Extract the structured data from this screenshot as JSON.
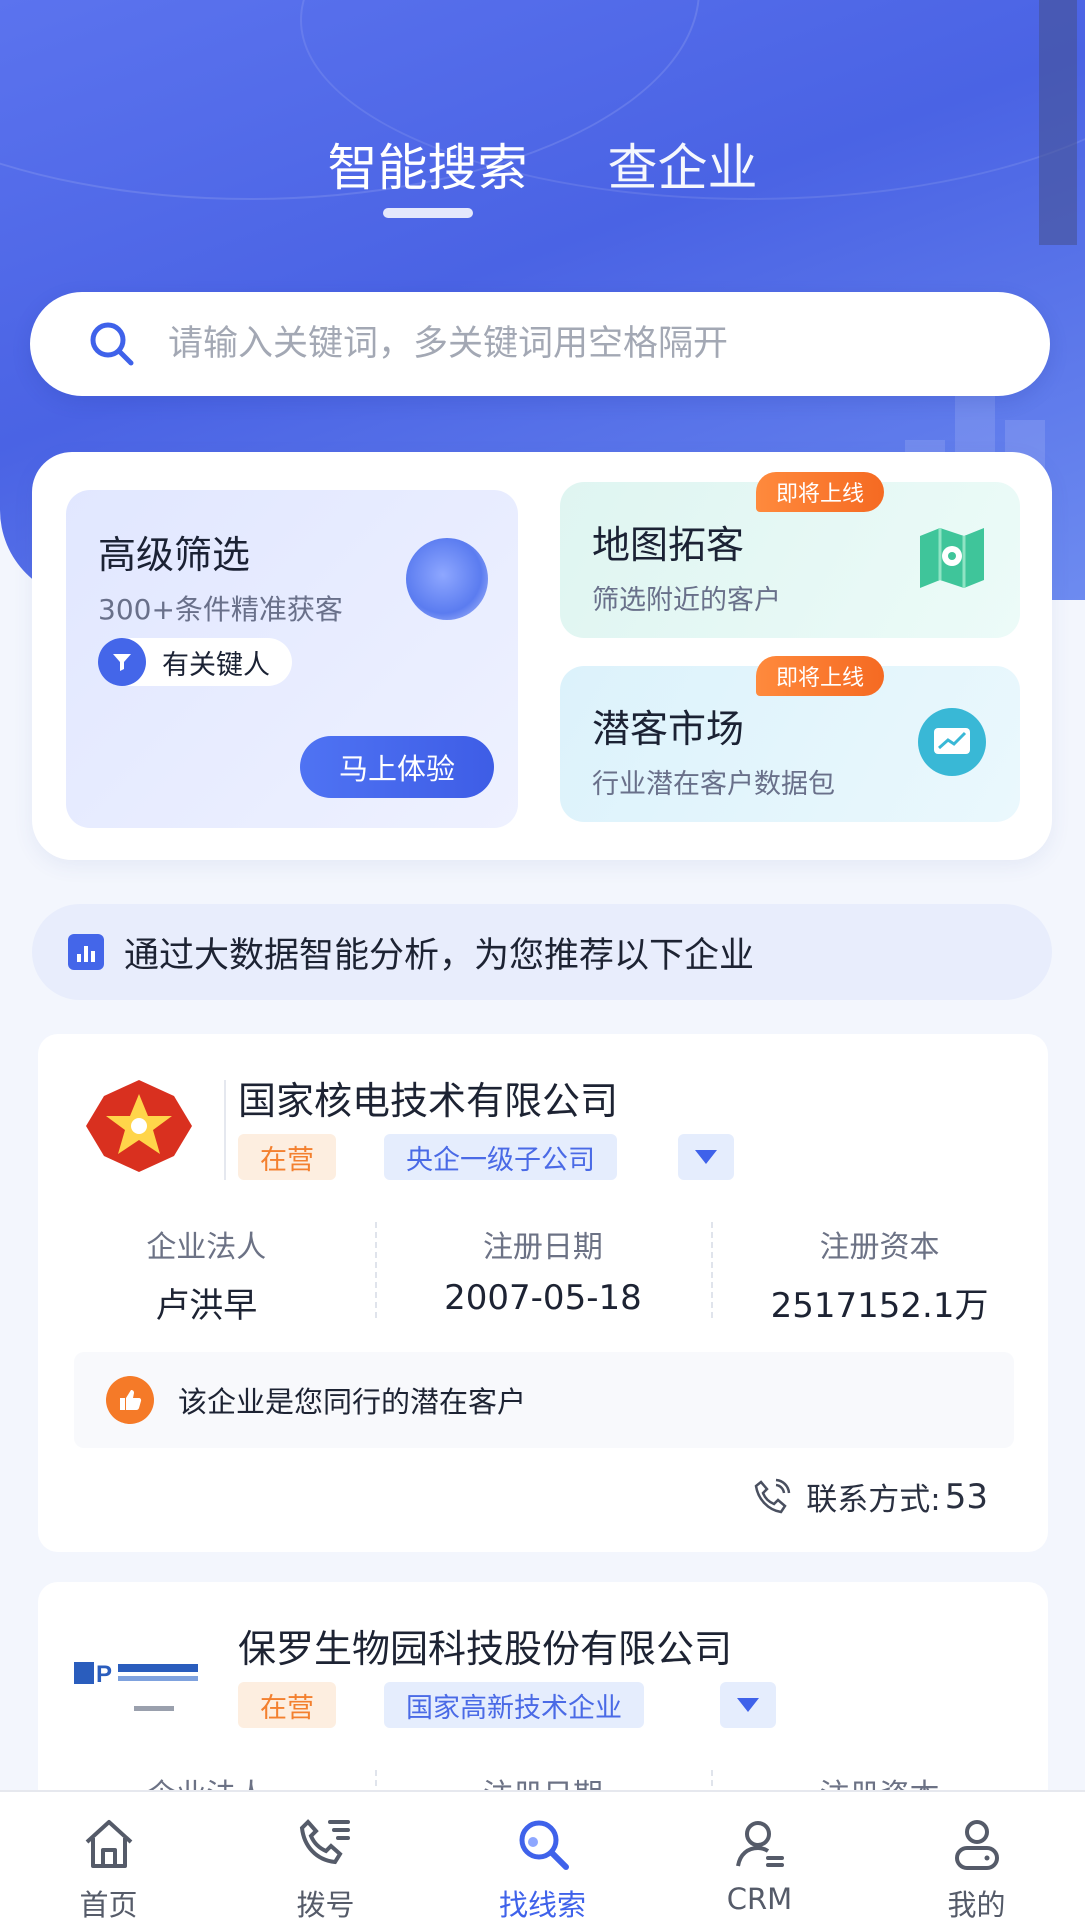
{
  "tabs": [
    {
      "label": "智能搜索",
      "active": true
    },
    {
      "label": "查企业",
      "active": false
    }
  ],
  "search": {
    "placeholder": "请输入关键词，多关键词用空格隔开"
  },
  "features": {
    "advanced": {
      "title": "高级筛选",
      "subtitle": "300+条件精准获客",
      "pill": "有关键人",
      "cta": "马上体验"
    },
    "map": {
      "title": "地图拓客",
      "subtitle": "筛选附近的客户",
      "badge": "即将上线"
    },
    "market": {
      "title": "潜客市场",
      "subtitle": "行业潜在客户数据包",
      "badge": "即将上线"
    }
  },
  "notice": "通过大数据智能分析，为您推荐以下企业",
  "companies": [
    {
      "name": "国家核电技术有限公司",
      "status": "在营",
      "kind": "央企一级子公司",
      "stats": [
        {
          "label": "企业法人",
          "value": "卢洪早"
        },
        {
          "label": "注册日期",
          "value": "2007-05-18"
        },
        {
          "label": "注册资本",
          "value": "2517152.1万"
        }
      ],
      "hint": "该企业是您同行的潜在客户",
      "contact_label": "联系方式:",
      "contact_count": "53"
    },
    {
      "name": "保罗生物园科技股份有限公司",
      "status": "在营",
      "kind": "国家高新技术企业",
      "stats": [
        {
          "label": "企业法人"
        },
        {
          "label": "注册日期"
        },
        {
          "label": "注册资本"
        }
      ]
    }
  ],
  "nav": [
    {
      "label": "首页",
      "icon": "home-icon"
    },
    {
      "label": "拨号",
      "icon": "phone-dial-icon"
    },
    {
      "label": "找线索",
      "icon": "search-icon",
      "active": true
    },
    {
      "label": "CRM",
      "icon": "crm-icon"
    },
    {
      "label": "我的",
      "icon": "profile-icon"
    }
  ],
  "colors": {
    "primary": "#4466e9",
    "accent": "#f57a28",
    "active_nav": "#3f62ea"
  }
}
